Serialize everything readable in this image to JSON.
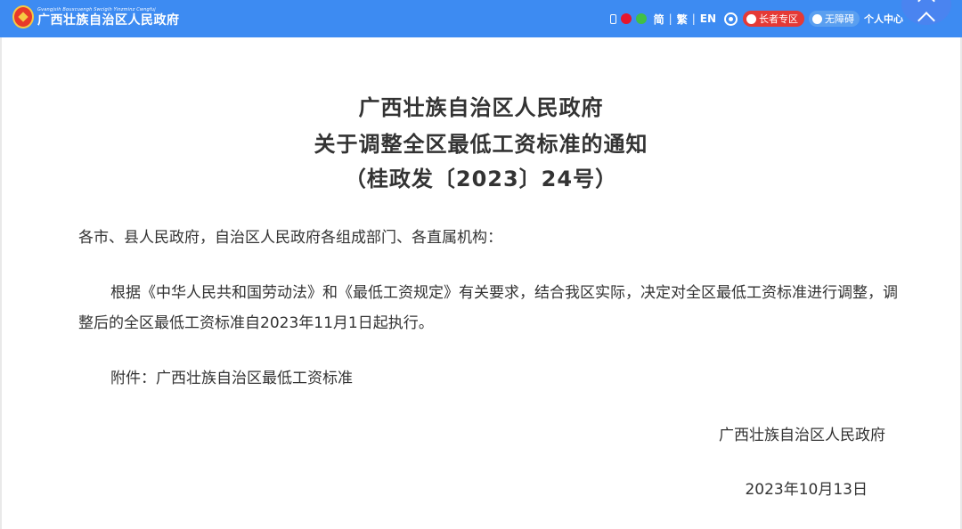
{
  "header": {
    "logo_zhuang": "Gvangjsih Bouxcuengh Swcigih Yinzminz Cwngfuj",
    "logo_text": "广西壮族自治区人民政府",
    "lang_simplified": "简",
    "lang_traditional": "繁",
    "lang_english": "EN",
    "separator": "|",
    "elder_zone": "长者专区",
    "accessibility": "无障碍",
    "personal_center": "个人中心"
  },
  "colors": {
    "topbar": "#3d8bf2",
    "elder_badge": "#e53935",
    "text": "#333333"
  },
  "document": {
    "title_line1": "广西壮族自治区人民政府",
    "title_line2": "关于调整全区最低工资标准的通知",
    "title_line3": "（桂政发〔2023〕24号）",
    "salutation": "各市、县人民政府，自治区人民政府各组成部门、各直属机构：",
    "body": "根据《中华人民共和国劳动法》和《最低工资规定》有关要求，结合我区实际，决定对全区最低工资标准进行调整，调整后的全区最低工资标准自2023年11月1日起执行。",
    "attachment": "附件：广西壮族自治区最低工资标准",
    "issuer": "广西壮族自治区人民政府",
    "date": "2023年10月13日"
  }
}
